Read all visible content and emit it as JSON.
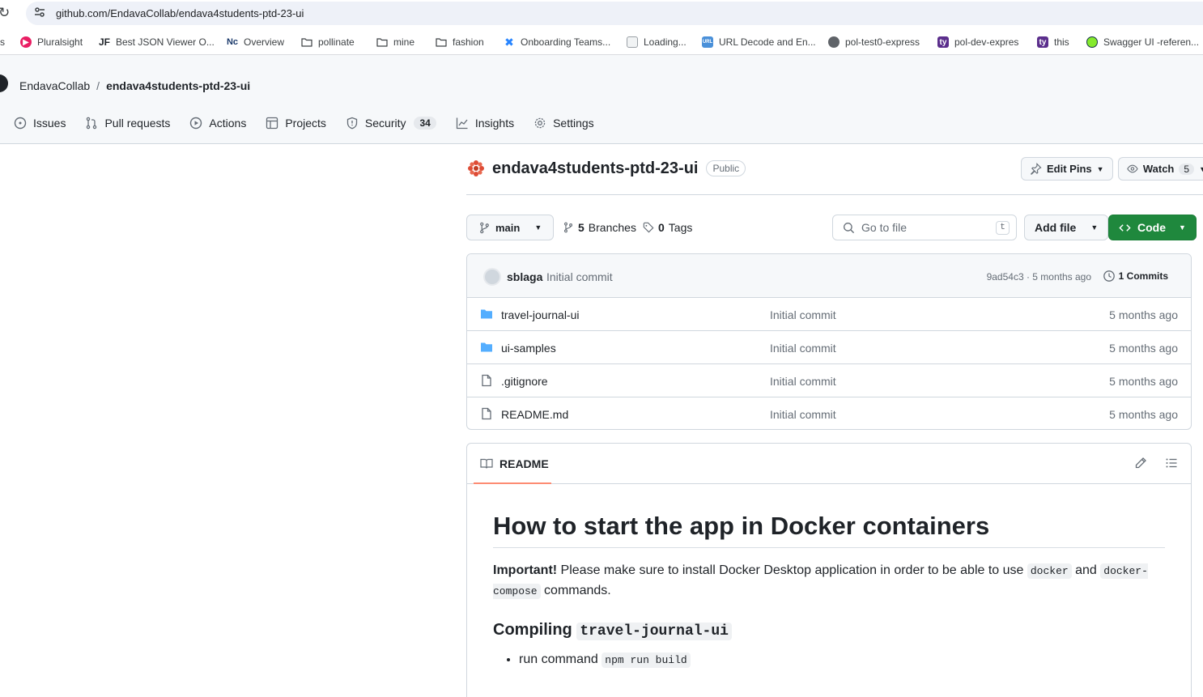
{
  "browser": {
    "url": "github.com/EndavaCollab/endava4students-ptd-23-ui",
    "bookmarks": [
      {
        "label": "s",
        "icon": "none"
      },
      {
        "label": "Pluralsight",
        "icon": "pluralsight-icon"
      },
      {
        "label": "Best JSON Viewer O...",
        "icon": "jf-icon"
      },
      {
        "label": "Overview",
        "icon": "nc-icon"
      },
      {
        "label": "pollinate",
        "icon": "folder-icon"
      },
      {
        "label": "mine",
        "icon": "folder-icon"
      },
      {
        "label": "fashion",
        "icon": "folder-icon"
      },
      {
        "label": "Onboarding Teams...",
        "icon": "jira-icon"
      },
      {
        "label": "Loading...",
        "icon": "document-icon"
      },
      {
        "label": "URL Decode and En...",
        "icon": "url-icon"
      },
      {
        "label": "pol-test0-express",
        "icon": "globe-icon"
      },
      {
        "label": "pol-dev-expres",
        "icon": "tyk-icon"
      },
      {
        "label": "this",
        "icon": "tyk-icon"
      },
      {
        "label": "Swagger UI -referen...",
        "icon": "swagger-icon"
      }
    ]
  },
  "header": {
    "owner": "EndavaCollab",
    "separator": "/",
    "repo": "endava4students-ptd-23-ui",
    "tabs": [
      {
        "label": "Issues",
        "icon": "issue-opened-icon"
      },
      {
        "label": "Pull requests",
        "icon": "git-pull-request-icon"
      },
      {
        "label": "Actions",
        "icon": "play-icon"
      },
      {
        "label": "Projects",
        "icon": "table-icon"
      },
      {
        "label": "Security",
        "icon": "shield-icon",
        "count": "34"
      },
      {
        "label": "Insights",
        "icon": "graph-icon"
      },
      {
        "label": "Settings",
        "icon": "gear-icon"
      }
    ]
  },
  "repo": {
    "name": "endava4students-ptd-23-ui",
    "visibility": "Public",
    "edit_pins": "Edit Pins",
    "watch": "Watch",
    "watch_count": "5"
  },
  "branchbar": {
    "branch": "main",
    "branches_count": "5",
    "branches_label": "Branches",
    "tags_count": "0",
    "tags_label": "Tags",
    "search_placeholder": "Go to file",
    "search_shortcut": "t",
    "add_file": "Add file",
    "code": "Code"
  },
  "latest_commit": {
    "author": "sblaga",
    "message": "Initial commit",
    "meta": "9ad54c3 · 5 months ago",
    "commits_label": "1 Commits"
  },
  "files": [
    {
      "name": "travel-journal-ui",
      "type": "folder",
      "message": "Initial commit",
      "age": "5 months ago"
    },
    {
      "name": "ui-samples",
      "type": "folder",
      "message": "Initial commit",
      "age": "5 months ago"
    },
    {
      "name": ".gitignore",
      "type": "file",
      "message": "Initial commit",
      "age": "5 months ago"
    },
    {
      "name": "README.md",
      "type": "file",
      "message": "Initial commit",
      "age": "5 months ago"
    }
  ],
  "readme": {
    "tab": "README",
    "heading": "How to start the app in Docker containers",
    "important_label": "Important!",
    "intro": " Please make sure to install Docker Desktop application in order to be able to use ",
    "code_docker": "docker",
    "and": " and ",
    "code_compose": "docker-compose",
    "commands": " commands.",
    "section_prefix": "Compiling ",
    "section_code": "travel-journal-ui",
    "bullet_text": "run command ",
    "bullet_code": "npm run build"
  },
  "colors": {
    "accent_green": "#1f883d",
    "folder_blue": "#54aeff",
    "underline_orange": "#fd8c73"
  }
}
